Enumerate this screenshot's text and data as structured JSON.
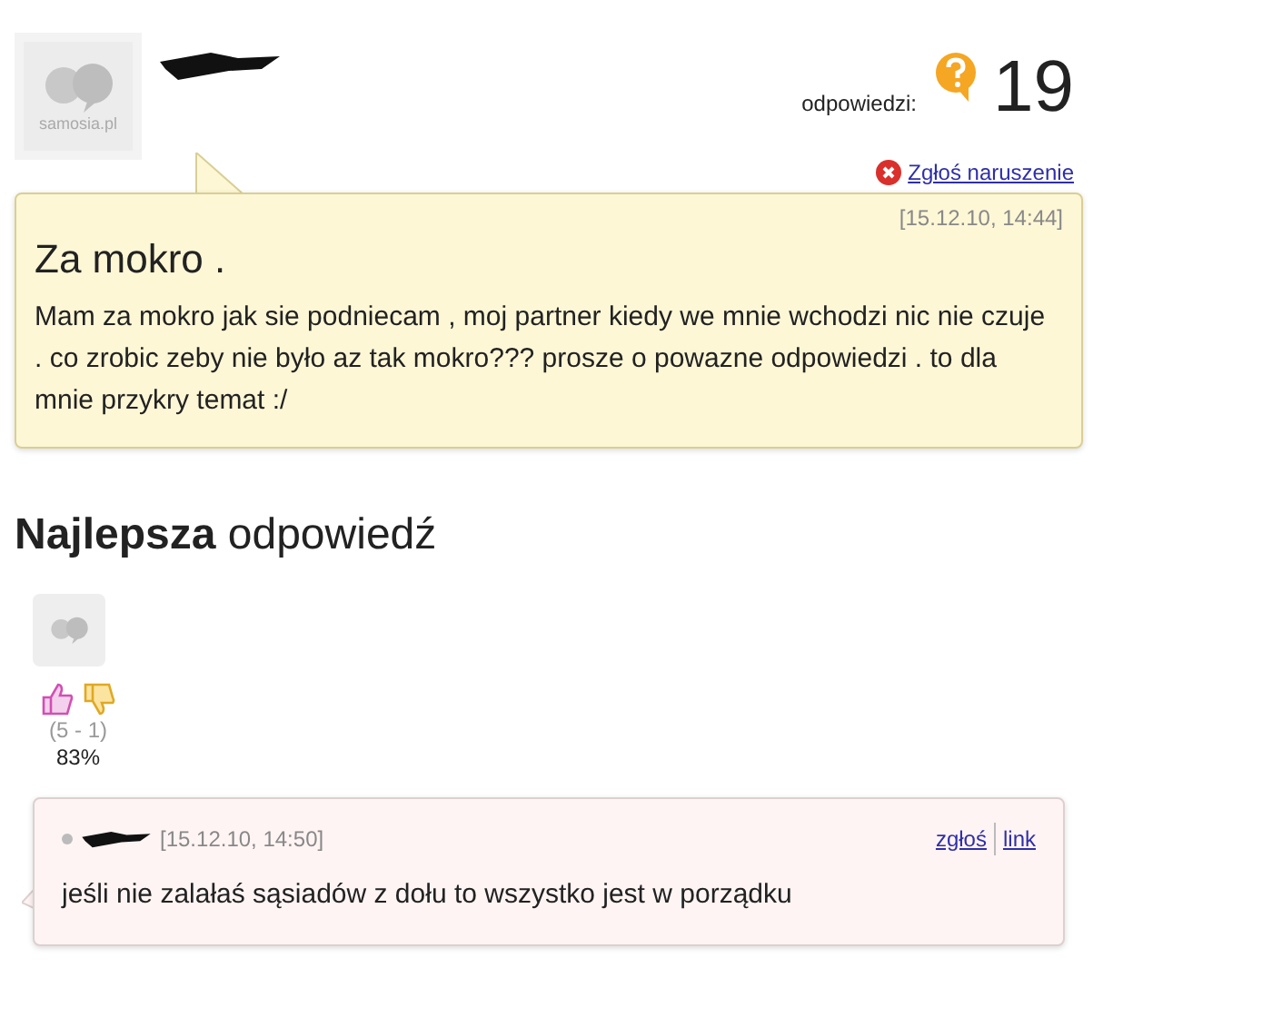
{
  "question": {
    "avatar_label": "samosia.pl",
    "answers_label": "odpowiedzi:",
    "answers_count": "19",
    "report_link": "Zgłoś naruszenie",
    "date": "[15.12.10, 14:44]",
    "title": "Za mokro .",
    "body": "Mam za mokro jak sie podniecam , moj partner kiedy we mnie wchodzi nic nie czuje . co zrobic zeby nie było az tak mokro??? prosze o powazne odpowiedzi . to dla mnie przykry temat :/"
  },
  "best_answer": {
    "heading": "**Najlepsza** odpowiedź",
    "votes": "(5 - 1)",
    "percent": "83%",
    "date": "[15.12.10, 14:50]",
    "report_link": "zgłoś",
    "link": "link",
    "body": "jeśli nie zalałaś sąsiadów z dołu to wszystko jest w porządku"
  }
}
